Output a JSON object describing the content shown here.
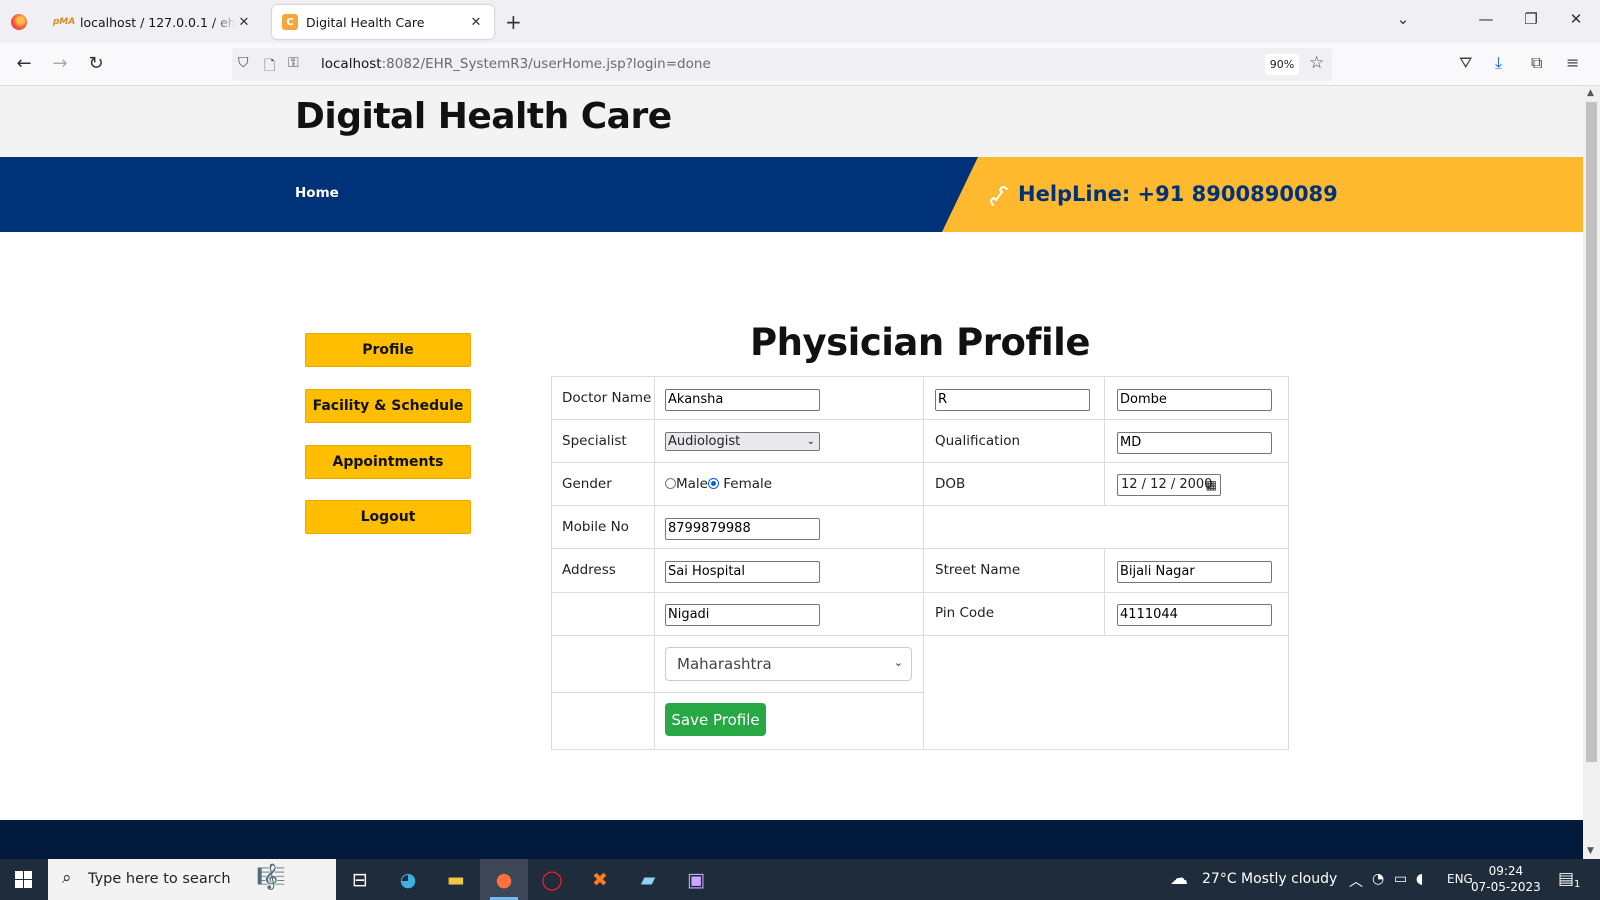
{
  "browser": {
    "tabs": [
      {
        "title": "localhost / 127.0.0.1 / ehr_system",
        "favicon": "phpmyadmin-icon"
      },
      {
        "title": "Digital Health Care",
        "favicon": "site-c-icon"
      }
    ],
    "url": {
      "host": "localhost",
      "rest": ":8082/EHR_SystemR3/userHome.jsp?login=done"
    },
    "zoom": "90%"
  },
  "site": {
    "title": "Digital Health Care",
    "nav": {
      "home": "Home"
    },
    "helpline": "HelpLine: +91 8900890089"
  },
  "sidebar": {
    "items": [
      {
        "label": "Profile"
      },
      {
        "label": "Facility & Schedule"
      },
      {
        "label": "Appointments"
      },
      {
        "label": "Logout"
      }
    ]
  },
  "profile": {
    "heading": "Physician Profile",
    "labels": {
      "doctor_name": "Doctor Name",
      "specialist": "Specialist",
      "qualification": "Qualification",
      "gender": "Gender",
      "dob": "DOB",
      "mobile": "Mobile No",
      "address": "Address",
      "street": "Street Name",
      "pin": "Pin Code"
    },
    "values": {
      "first_name": "Akansha",
      "middle_name": "R",
      "last_name": "Dombe",
      "specialist": "Audiologist",
      "qualification": "MD",
      "gender_male": "Male",
      "gender_female": "Female",
      "gender_selected": "Female",
      "dob": "12 / 12 / 2000",
      "mobile": "8799879988",
      "address": "Sai Hospital",
      "street": "Bijali Nagar",
      "city": "Nigadi",
      "pin": "4111044",
      "state": "Maharashtra"
    },
    "save_label": "Save Profile"
  },
  "taskbar": {
    "search_placeholder": "Type here to search",
    "weather": "27°C  Mostly cloudy",
    "language": "ENG",
    "time": "09:24",
    "date": "07-05-2023",
    "notification_count": "1"
  }
}
